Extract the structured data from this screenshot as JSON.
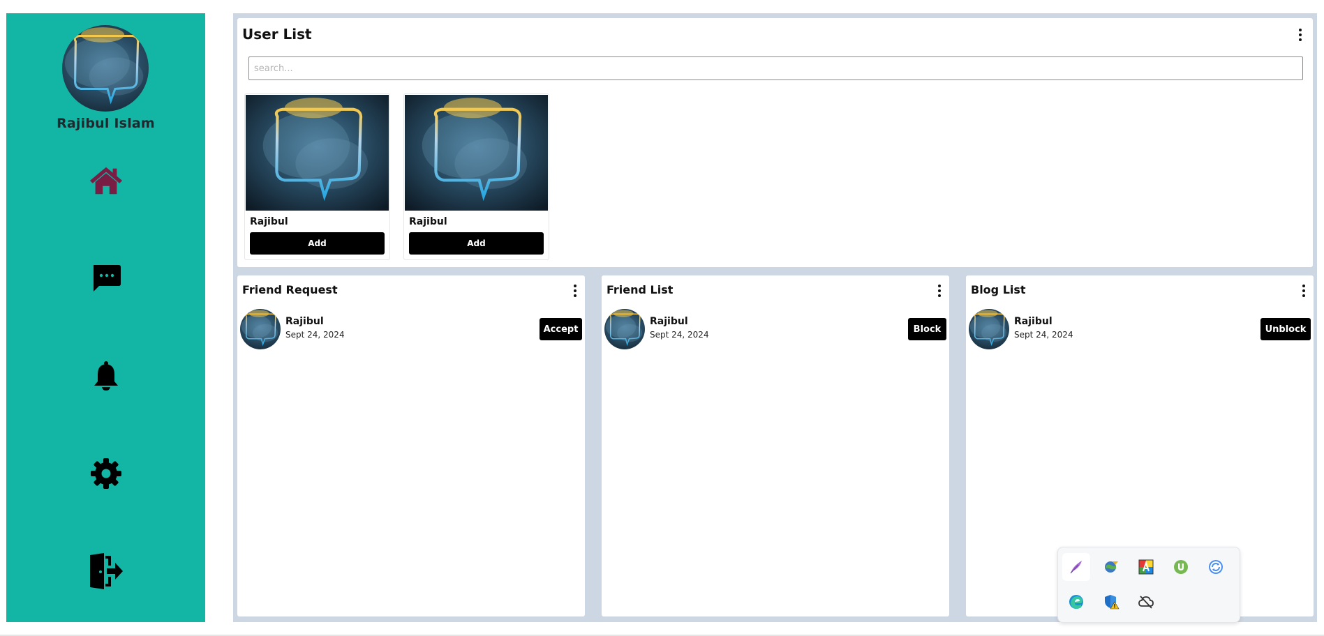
{
  "profile": {
    "name": "Rajibul Islam"
  },
  "nav": [
    "home-icon",
    "chat-icon",
    "bell-icon",
    "gear-icon",
    "logout-icon"
  ],
  "colors": {
    "sidebar": "#13b5a4",
    "home_icon": "#7a1d45",
    "panel_bg": "#cdd6e3",
    "button": "#000000"
  },
  "user_list": {
    "title": "User List",
    "search_placeholder": "search...",
    "users": [
      {
        "name": "Rajibul",
        "button": "Add"
      },
      {
        "name": "Rajibul",
        "button": "Add"
      }
    ]
  },
  "friend_request": {
    "title": "Friend Request",
    "item": {
      "name": "Rajibul",
      "date": "Sept 24, 2024",
      "button": "Accept"
    }
  },
  "friend_list": {
    "title": "Friend List",
    "item": {
      "name": "Rajibul",
      "date": "Sept 24, 2024",
      "button": "Block"
    }
  },
  "blog_list": {
    "title": "Blog List",
    "item": {
      "name": "Rajibul",
      "date": "Sept 24, 2024",
      "button": "Unblock"
    }
  },
  "tray": [
    "feather-icon",
    "globe-download-icon",
    "color-picker-icon",
    "torrent-icon",
    "sync-icon",
    "edge-icon",
    "defender-warning-icon",
    "cloud-off-icon"
  ]
}
